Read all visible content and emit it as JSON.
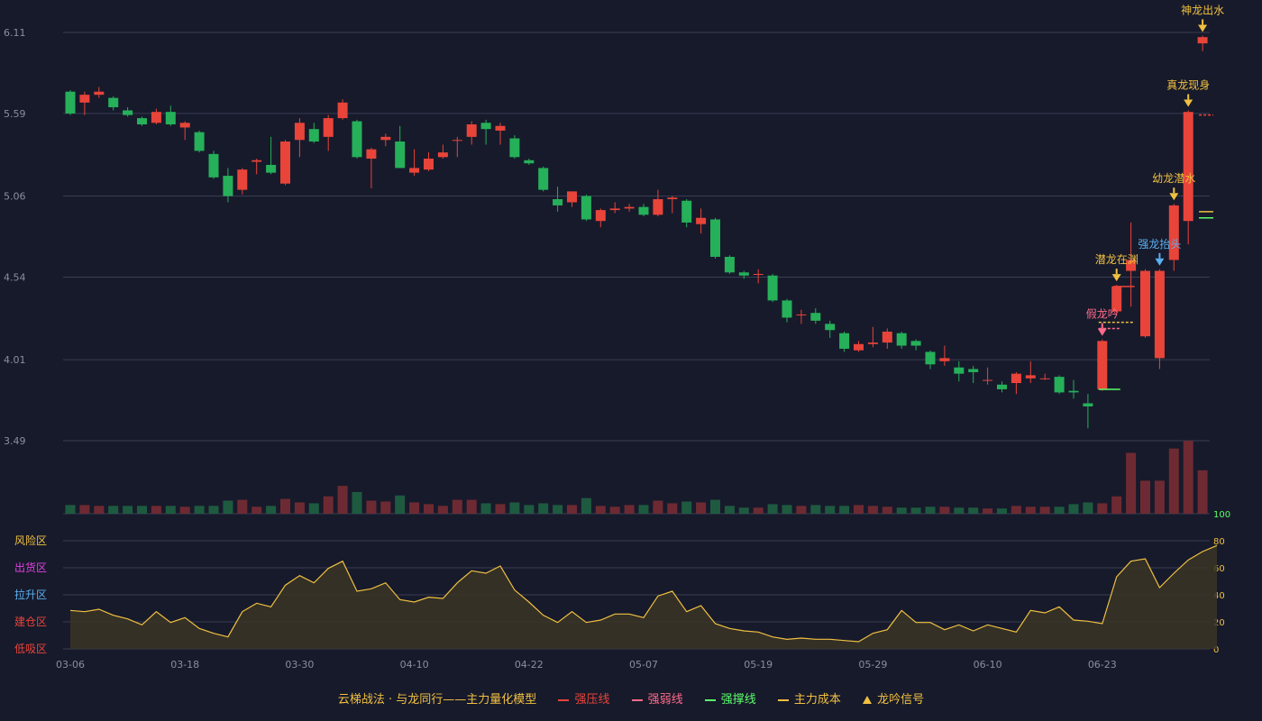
{
  "colors": {
    "background": "#171a2b",
    "up": "#e8443a",
    "down": "#26b05a",
    "grid": "#3a3e52",
    "axis_text": "#8a8ea0",
    "yellow": "#f0c040",
    "blue": "#5ab0f0"
  },
  "legend": {
    "title": "云梯战法 · 与龙同行——主力量化模型",
    "items": [
      {
        "label": "强压线",
        "color": "#e8443a",
        "style": "solid"
      },
      {
        "label": "强弱线",
        "color": "#ff6b8a",
        "style": "dashed"
      },
      {
        "label": "强撑线",
        "color": "#5cff6a",
        "style": "solid"
      },
      {
        "label": "主力成本",
        "color": "#f0c040",
        "style": "dashed"
      },
      {
        "label": "龙吟信号",
        "color": "#f0c040",
        "style": "triangle"
      }
    ]
  },
  "chart_data": {
    "type": "candlestick",
    "price_axis": {
      "ticks": [
        6.11,
        5.59,
        5.06,
        4.54,
        4.01,
        3.49
      ],
      "ylim": [
        3.49,
        6.11
      ]
    },
    "x_tick_labels": [
      {
        "i": 0,
        "label": "03-06"
      },
      {
        "i": 8,
        "label": "03-18"
      },
      {
        "i": 16,
        "label": "03-30"
      },
      {
        "i": 24,
        "label": "04-10"
      },
      {
        "i": 32,
        "label": "04-22"
      },
      {
        "i": 40,
        "label": "05-07"
      },
      {
        "i": 48,
        "label": "05-19"
      },
      {
        "i": 56,
        "label": "05-29"
      },
      {
        "i": 64,
        "label": "06-10"
      },
      {
        "i": 72,
        "label": "06-23"
      }
    ],
    "candles": [
      [
        5.73,
        5.59,
        5.74,
        5.58
      ],
      [
        5.66,
        5.71,
        5.73,
        5.58
      ],
      [
        5.71,
        5.73,
        5.76,
        5.69
      ],
      [
        5.69,
        5.63,
        5.7,
        5.61
      ],
      [
        5.61,
        5.58,
        5.63,
        5.57
      ],
      [
        5.56,
        5.52,
        5.57,
        5.51
      ],
      [
        5.53,
        5.6,
        5.62,
        5.52
      ],
      [
        5.6,
        5.52,
        5.64,
        5.51
      ],
      [
        5.5,
        5.53,
        5.54,
        5.42
      ],
      [
        5.47,
        5.35,
        5.48,
        5.34
      ],
      [
        5.33,
        5.18,
        5.35,
        5.17
      ],
      [
        5.19,
        5.06,
        5.24,
        5.02
      ],
      [
        5.1,
        5.23,
        5.24,
        5.07
      ],
      [
        5.28,
        5.29,
        5.3,
        5.2
      ],
      [
        5.26,
        5.21,
        5.44,
        5.2
      ],
      [
        5.14,
        5.41,
        5.42,
        5.13
      ],
      [
        5.42,
        5.53,
        5.56,
        5.31
      ],
      [
        5.49,
        5.41,
        5.53,
        5.4
      ],
      [
        5.44,
        5.56,
        5.58,
        5.35
      ],
      [
        5.56,
        5.66,
        5.68,
        5.55
      ],
      [
        5.54,
        5.31,
        5.55,
        5.3
      ],
      [
        5.3,
        5.36,
        5.37,
        5.11
      ],
      [
        5.42,
        5.44,
        5.46,
        5.38
      ],
      [
        5.41,
        5.24,
        5.51,
        5.24
      ],
      [
        5.21,
        5.24,
        5.36,
        5.19
      ],
      [
        5.23,
        5.3,
        5.34,
        5.22
      ],
      [
        5.31,
        5.34,
        5.39,
        5.3
      ],
      [
        5.42,
        5.42,
        5.44,
        5.31
      ],
      [
        5.44,
        5.52,
        5.54,
        5.39
      ],
      [
        5.53,
        5.49,
        5.55,
        5.39
      ],
      [
        5.48,
        5.51,
        5.53,
        5.39
      ],
      [
        5.43,
        5.31,
        5.45,
        5.3
      ],
      [
        5.29,
        5.27,
        5.3,
        5.26
      ],
      [
        5.24,
        5.1,
        5.25,
        5.09
      ],
      [
        5.04,
        5.0,
        5.12,
        4.96
      ],
      [
        5.02,
        5.09,
        5.09,
        4.99
      ],
      [
        5.06,
        4.91,
        5.07,
        4.9
      ],
      [
        4.9,
        4.97,
        4.98,
        4.86
      ],
      [
        4.97,
        4.98,
        5.02,
        4.95
      ],
      [
        4.98,
        4.99,
        5.01,
        4.96
      ],
      [
        4.99,
        4.94,
        5.01,
        4.93
      ],
      [
        4.94,
        5.04,
        5.1,
        4.93
      ],
      [
        5.04,
        5.05,
        5.06,
        4.95
      ],
      [
        5.03,
        4.89,
        5.04,
        4.86
      ],
      [
        4.88,
        4.92,
        4.98,
        4.82
      ],
      [
        4.91,
        4.67,
        4.92,
        4.66
      ],
      [
        4.67,
        4.57,
        4.68,
        4.56
      ],
      [
        4.57,
        4.55,
        4.58,
        4.53
      ],
      [
        4.56,
        4.56,
        4.59,
        4.5
      ],
      [
        4.55,
        4.39,
        4.56,
        4.38
      ],
      [
        4.39,
        4.28,
        4.4,
        4.25
      ],
      [
        4.3,
        4.3,
        4.33,
        4.24
      ],
      [
        4.31,
        4.26,
        4.34,
        4.24
      ],
      [
        4.24,
        4.2,
        4.26,
        4.15
      ],
      [
        4.18,
        4.08,
        4.19,
        4.06
      ],
      [
        4.07,
        4.11,
        4.13,
        4.06
      ],
      [
        4.11,
        4.12,
        4.22,
        4.09
      ],
      [
        4.12,
        4.19,
        4.21,
        4.08
      ],
      [
        4.18,
        4.1,
        4.19,
        4.08
      ],
      [
        4.13,
        4.1,
        4.14,
        4.07
      ],
      [
        4.06,
        3.98,
        4.07,
        3.95
      ],
      [
        4.0,
        4.02,
        4.1,
        3.97
      ],
      [
        3.96,
        3.92,
        4.0,
        3.87
      ],
      [
        3.95,
        3.93,
        3.97,
        3.86
      ],
      [
        3.88,
        3.88,
        3.96,
        3.85
      ],
      [
        3.85,
        3.82,
        3.87,
        3.8
      ],
      [
        3.86,
        3.92,
        3.93,
        3.79
      ],
      [
        3.89,
        3.91,
        4.0,
        3.86
      ],
      [
        3.89,
        3.89,
        3.92,
        3.88
      ],
      [
        3.9,
        3.8,
        3.91,
        3.79
      ],
      [
        3.81,
        3.8,
        3.88,
        3.76
      ],
      [
        3.73,
        3.71,
        3.79,
        3.57
      ],
      [
        3.82,
        4.13,
        4.14,
        3.81
      ],
      [
        4.32,
        4.48,
        4.49,
        4.3
      ],
      [
        4.58,
        4.65,
        4.89,
        4.35
      ],
      [
        4.16,
        4.58,
        4.59,
        4.15
      ],
      [
        4.02,
        4.58,
        4.59,
        3.95
      ],
      [
        4.65,
        5.0,
        5.01,
        4.58
      ],
      [
        4.9,
        5.6,
        5.61,
        4.75
      ],
      [
        6.04,
        6.08,
        6.09,
        5.99
      ]
    ],
    "levels": [
      {
        "label": "强压线",
        "points": [
          [
            73,
            4.48
          ],
          [
            74,
            4.48
          ]
        ],
        "color": "#e8443a",
        "style": "solid"
      },
      {
        "label": "强弱线",
        "points": [
          [
            72,
            4.21
          ],
          [
            73,
            4.21
          ]
        ],
        "color": "#ff6b8a",
        "style": "dashed"
      },
      {
        "label": "强撑线",
        "points": [
          [
            72,
            3.82
          ],
          [
            73,
            3.82
          ]
        ],
        "color": "#5cff6a",
        "style": "solid"
      },
      {
        "label": "主力成本",
        "points": [
          [
            72,
            4.25
          ],
          [
            74,
            4.25
          ]
        ],
        "color": "#f0c040",
        "style": "dashed"
      },
      {
        "label": "强压线",
        "points": [
          [
            79,
            5.58
          ],
          [
            79.5,
            5.58
          ]
        ],
        "color": "#e8443a",
        "style": "dashed"
      },
      {
        "label": "主力成本",
        "points": [
          [
            79,
            4.96
          ],
          [
            79.5,
            4.96
          ]
        ],
        "color": "#f0c040",
        "style": "solid"
      },
      {
        "label": "强撑线",
        "points": [
          [
            79,
            4.92
          ],
          [
            79.5,
            4.92
          ]
        ],
        "color": "#5cff6a",
        "style": "solid"
      }
    ],
    "signals": [
      {
        "i": 72,
        "label": "假龙吟",
        "color": "#ff6b8a"
      },
      {
        "i": 73,
        "label": "潜龙在渊",
        "color": "#f0c040"
      },
      {
        "i": 76,
        "label": "强龙抬头",
        "color": "#5ab0f0"
      },
      {
        "i": 77,
        "label": "幼龙潜水",
        "color": "#f0c040"
      },
      {
        "i": 78,
        "label": "真龙现身",
        "color": "#f0c040"
      },
      {
        "i": 79,
        "label": "神龙出水",
        "color": "#f0c040"
      }
    ],
    "volume": [
      10,
      10,
      9,
      9,
      9,
      9,
      9,
      9,
      8,
      9,
      9,
      15,
      16,
      8,
      9,
      17,
      13,
      12,
      20,
      32,
      25,
      15,
      14,
      21,
      13,
      11,
      9,
      16,
      16,
      12,
      11,
      13,
      10,
      12,
      10,
      10,
      18,
      9,
      8,
      10,
      10,
      15,
      12,
      14,
      13,
      16,
      9,
      7,
      7,
      11,
      10,
      9,
      10,
      9,
      9,
      10,
      9,
      8,
      7,
      7,
      8,
      8,
      7,
      7,
      6,
      6,
      9,
      8,
      8,
      8,
      11,
      13,
      12,
      20,
      70,
      38,
      38,
      75,
      84,
      50
    ],
    "indicator": {
      "ylim": [
        0,
        90
      ],
      "ticks": [
        0,
        20,
        40,
        60,
        80,
        100
      ],
      "zones": [
        "风险区",
        "出货区",
        "拉升区",
        "建仓区",
        "低吸区"
      ],
      "zone_colors": [
        "#f0c040",
        "#e040e0",
        "#5ab0f0",
        "#e8443a",
        "#e8443a"
      ],
      "values": [
        32,
        31,
        33,
        28,
        25,
        20,
        31,
        22,
        26,
        17,
        13,
        10,
        31,
        38,
        35,
        53,
        61,
        55,
        67,
        73,
        48,
        50,
        55,
        41,
        39,
        43,
        42,
        55,
        65,
        63,
        69,
        49,
        39,
        28,
        22,
        31,
        22,
        24,
        29,
        29,
        26,
        44,
        48,
        31,
        36,
        21,
        17,
        15,
        14,
        10,
        8,
        9,
        8,
        8,
        7,
        6,
        13,
        16,
        32,
        22,
        22,
        16,
        20,
        15,
        20,
        17,
        14,
        32,
        30,
        35,
        24,
        23,
        21,
        60,
        73,
        75,
        51,
        63,
        74,
        81,
        86
      ]
    }
  }
}
